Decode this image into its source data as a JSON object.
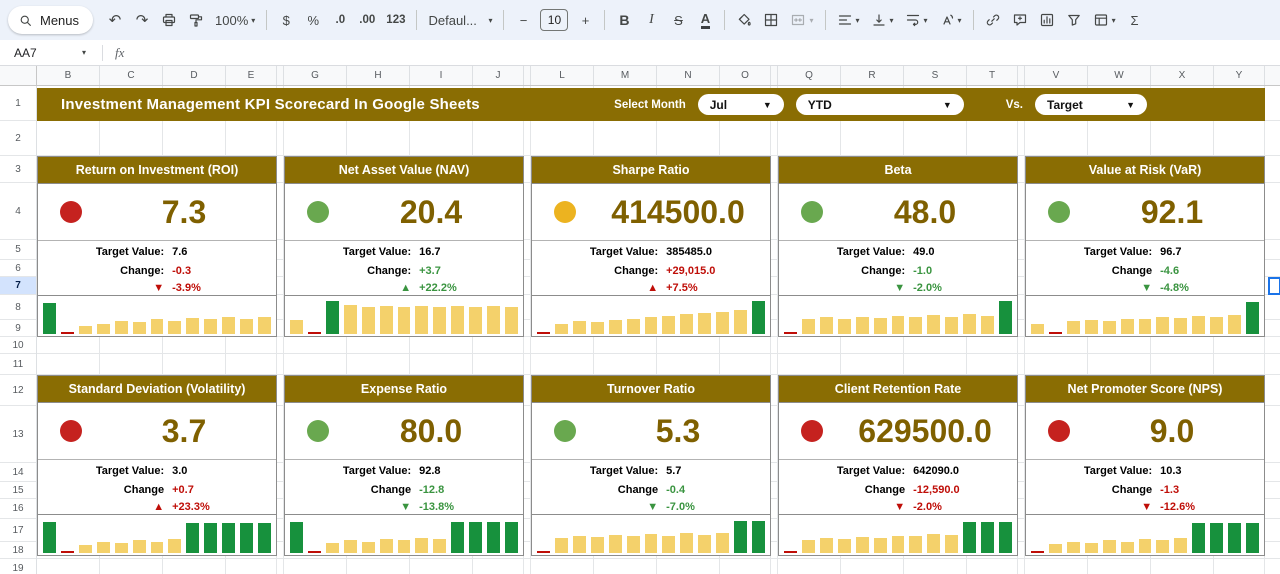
{
  "colors": {
    "gold_bg": "#8a6d03",
    "gold_text": "#7f6000",
    "status_red": "#c5221f",
    "status_green": "#69a84f",
    "status_yellow": "#ecb320",
    "negative_text": "#bf0e08",
    "positive_text": "#3a9440",
    "green_bar": "#17913d",
    "yellow_bar": "#f4d16b",
    "selection": "#1a73e8",
    "active_row_bg": "#d3e3fd"
  },
  "icons": {
    "undo": "↶",
    "redo": "↷",
    "caret": "▾",
    "minus": "−",
    "plus": "+",
    "up": "▲",
    "down": "▼"
  },
  "toolbar": {
    "menus_label": "Menus",
    "zoom_value": "100%",
    "currency_label": "$",
    "percent_label": "%",
    "decrease_decimal_label": ".0",
    "increase_decimal_label": ".00",
    "more_formats_label": "123",
    "font_value": "Defaul...",
    "font_size_value": "10",
    "bold_label": "B",
    "italic_label": "I",
    "strikethrough_label": "S",
    "text_color_label": "A",
    "functions_label": "Σ"
  },
  "formula_bar": {
    "cell_reference": "AA7",
    "fx_label": "fx"
  },
  "grid": {
    "columns": [
      "B",
      "C",
      "D",
      "E",
      "G",
      "H",
      "I",
      "J",
      "L",
      "M",
      "N",
      "O",
      "Q",
      "R",
      "S",
      "T",
      "V",
      "W",
      "X",
      "Y"
    ],
    "rows": [
      "1",
      "2",
      "3",
      "4",
      "5",
      "6",
      "7",
      "8",
      "9",
      "10",
      "11",
      "12",
      "13",
      "14",
      "15",
      "16",
      "17",
      "18",
      "19"
    ],
    "active_row": "7"
  },
  "banner": {
    "title": "Investment Management KPI Scorecard In Google Sheets",
    "select_month_label": "Select Month",
    "month_value": "Jul",
    "period_value": "YTD",
    "vs_label": "Vs.",
    "compare_value": "Target"
  },
  "cards": [
    {
      "title": "Return on Investment (ROI)",
      "status": "red",
      "value": "7.3",
      "target_label": "Target Value:",
      "target": "7.6",
      "change_label": "Change:",
      "change": "-0.3",
      "change_color": "red",
      "trend": "down",
      "trend_color": "red",
      "trend_pct": "-3.9%",
      "bars": [
        {
          "c": "g",
          "h": 90
        },
        {
          "c": "r",
          "h": 6
        },
        {
          "c": "y",
          "h": 22
        },
        {
          "c": "y",
          "h": 30
        },
        {
          "c": "y",
          "h": 38
        },
        {
          "c": "y",
          "h": 34
        },
        {
          "c": "y",
          "h": 42
        },
        {
          "c": "y",
          "h": 38
        },
        {
          "c": "y",
          "h": 46
        },
        {
          "c": "y",
          "h": 42
        },
        {
          "c": "y",
          "h": 48
        },
        {
          "c": "y",
          "h": 44
        },
        {
          "c": "y",
          "h": 50
        }
      ]
    },
    {
      "title": "Net Asset Value (NAV)",
      "status": "green",
      "value": "20.4",
      "target_label": "Target Value:",
      "target": "16.7",
      "change_label": "Change:",
      "change": "+3.7",
      "change_color": "green",
      "trend": "up",
      "trend_color": "green",
      "trend_pct": "+22.2%",
      "bars": [
        {
          "c": "y",
          "h": 40
        },
        {
          "c": "r",
          "h": 6
        },
        {
          "c": "g",
          "h": 95
        },
        {
          "c": "y",
          "h": 82
        },
        {
          "c": "y",
          "h": 78
        },
        {
          "c": "y",
          "h": 80
        },
        {
          "c": "y",
          "h": 76
        },
        {
          "c": "y",
          "h": 80
        },
        {
          "c": "y",
          "h": 76
        },
        {
          "c": "y",
          "h": 80
        },
        {
          "c": "y",
          "h": 78
        },
        {
          "c": "y",
          "h": 80
        },
        {
          "c": "y",
          "h": 78
        }
      ]
    },
    {
      "title": "Sharpe Ratio",
      "status": "yellow",
      "value": "414500.0",
      "target_label": "Target Value:",
      "target": "385485.0",
      "change_label": "Change:",
      "change": "+29,015.0",
      "change_color": "red",
      "trend": "up",
      "trend_color": "red",
      "trend_pct": "+7.5%",
      "bars": [
        {
          "c": "r",
          "h": 6
        },
        {
          "c": "y",
          "h": 30
        },
        {
          "c": "y",
          "h": 36
        },
        {
          "c": "y",
          "h": 34
        },
        {
          "c": "y",
          "h": 40
        },
        {
          "c": "y",
          "h": 44
        },
        {
          "c": "y",
          "h": 48
        },
        {
          "c": "y",
          "h": 52
        },
        {
          "c": "y",
          "h": 56
        },
        {
          "c": "y",
          "h": 60
        },
        {
          "c": "y",
          "h": 64
        },
        {
          "c": "y",
          "h": 68
        },
        {
          "c": "g",
          "h": 95
        }
      ]
    },
    {
      "title": "Beta",
      "status": "green",
      "value": "48.0",
      "target_label": "Target Value:",
      "target": "49.0",
      "change_label": "Change:",
      "change": "-1.0",
      "change_color": "green",
      "trend": "down",
      "trend_color": "green",
      "trend_pct": "-2.0%",
      "bars": [
        {
          "c": "r",
          "h": 6
        },
        {
          "c": "y",
          "h": 42
        },
        {
          "c": "y",
          "h": 48
        },
        {
          "c": "y",
          "h": 44
        },
        {
          "c": "y",
          "h": 50
        },
        {
          "c": "y",
          "h": 46
        },
        {
          "c": "y",
          "h": 52
        },
        {
          "c": "y",
          "h": 48
        },
        {
          "c": "y",
          "h": 54
        },
        {
          "c": "y",
          "h": 50
        },
        {
          "c": "y",
          "h": 56
        },
        {
          "c": "y",
          "h": 52
        },
        {
          "c": "g",
          "h": 95
        }
      ]
    },
    {
      "title": "Value at Risk (VaR)",
      "status": "green",
      "value": "92.1",
      "target_label": "Target Value:",
      "target": "96.7",
      "change_label": "Change",
      "change": "-4.6",
      "change_color": "green",
      "trend": "down",
      "trend_color": "green",
      "trend_pct": "-4.8%",
      "bars": [
        {
          "c": "y",
          "h": 30
        },
        {
          "c": "r",
          "h": 6
        },
        {
          "c": "y",
          "h": 36
        },
        {
          "c": "y",
          "h": 40
        },
        {
          "c": "y",
          "h": 38
        },
        {
          "c": "y",
          "h": 44
        },
        {
          "c": "y",
          "h": 42
        },
        {
          "c": "y",
          "h": 48
        },
        {
          "c": "y",
          "h": 46
        },
        {
          "c": "y",
          "h": 52
        },
        {
          "c": "y",
          "h": 50
        },
        {
          "c": "y",
          "h": 54
        },
        {
          "c": "g",
          "h": 92
        }
      ]
    },
    {
      "title": "Standard Deviation (Volatility)",
      "status": "red",
      "value": "3.7",
      "target_label": "Target Value:",
      "target": "3.0",
      "change_label": "Change",
      "change": "+0.7",
      "change_color": "red",
      "trend": "up",
      "trend_color": "red",
      "trend_pct": "+23.3%",
      "bars": [
        {
          "c": "g",
          "h": 90
        },
        {
          "c": "r",
          "h": 6
        },
        {
          "c": "y",
          "h": 24
        },
        {
          "c": "y",
          "h": 32
        },
        {
          "c": "y",
          "h": 28
        },
        {
          "c": "y",
          "h": 36
        },
        {
          "c": "y",
          "h": 32
        },
        {
          "c": "y",
          "h": 40
        },
        {
          "c": "g",
          "h": 85
        },
        {
          "c": "g",
          "h": 85
        },
        {
          "c": "g",
          "h": 85
        },
        {
          "c": "g",
          "h": 85
        },
        {
          "c": "g",
          "h": 85
        }
      ]
    },
    {
      "title": "Expense Ratio",
      "status": "green",
      "value": "80.0",
      "target_label": "Target Value:",
      "target": "92.8",
      "change_label": "Change",
      "change": "-12.8",
      "change_color": "green",
      "trend": "down",
      "trend_color": "green",
      "trend_pct": "-13.8%",
      "bars": [
        {
          "c": "g",
          "h": 90
        },
        {
          "c": "r",
          "h": 6
        },
        {
          "c": "y",
          "h": 30
        },
        {
          "c": "y",
          "h": 36
        },
        {
          "c": "y",
          "h": 32
        },
        {
          "c": "y",
          "h": 40
        },
        {
          "c": "y",
          "h": 36
        },
        {
          "c": "y",
          "h": 44
        },
        {
          "c": "y",
          "h": 40
        },
        {
          "c": "g",
          "h": 88
        },
        {
          "c": "g",
          "h": 88
        },
        {
          "c": "g",
          "h": 88
        },
        {
          "c": "g",
          "h": 88
        }
      ]
    },
    {
      "title": "Turnover Ratio",
      "status": "green",
      "value": "5.3",
      "target_label": "Target Value:",
      "target": "5.7",
      "change_label": "Change",
      "change": "-0.4",
      "change_color": "green",
      "trend": "down",
      "trend_color": "green",
      "trend_pct": "-7.0%",
      "bars": [
        {
          "c": "r",
          "h": 6
        },
        {
          "c": "y",
          "h": 44
        },
        {
          "c": "y",
          "h": 50
        },
        {
          "c": "y",
          "h": 46
        },
        {
          "c": "y",
          "h": 52
        },
        {
          "c": "y",
          "h": 48
        },
        {
          "c": "y",
          "h": 54
        },
        {
          "c": "y",
          "h": 50
        },
        {
          "c": "y",
          "h": 56
        },
        {
          "c": "y",
          "h": 52
        },
        {
          "c": "y",
          "h": 58
        },
        {
          "c": "g",
          "h": 92
        },
        {
          "c": "g",
          "h": 92
        }
      ]
    },
    {
      "title": "Client Retention Rate",
      "status": "red",
      "value": "629500.0",
      "target_label": "Target Value:",
      "target": "642090.0",
      "change_label": "Change",
      "change": "-12,590.0",
      "change_color": "red",
      "trend": "down",
      "trend_color": "red",
      "trend_pct": "-2.0%",
      "bars": [
        {
          "c": "r",
          "h": 6
        },
        {
          "c": "y",
          "h": 36
        },
        {
          "c": "y",
          "h": 42
        },
        {
          "c": "y",
          "h": 40
        },
        {
          "c": "y",
          "h": 46
        },
        {
          "c": "y",
          "h": 44
        },
        {
          "c": "y",
          "h": 50
        },
        {
          "c": "y",
          "h": 48
        },
        {
          "c": "y",
          "h": 54
        },
        {
          "c": "y",
          "h": 52
        },
        {
          "c": "g",
          "h": 88
        },
        {
          "c": "g",
          "h": 88
        },
        {
          "c": "g",
          "h": 88
        }
      ]
    },
    {
      "title": "Net Promoter Score (NPS)",
      "status": "red",
      "value": "9.0",
      "target_label": "Target Value:",
      "target": "10.3",
      "change_label": "Change",
      "change": "-1.3",
      "change_color": "red",
      "trend": "down",
      "trend_color": "red",
      "trend_pct": "-12.6%",
      "bars": [
        {
          "c": "r",
          "h": 6
        },
        {
          "c": "y",
          "h": 26
        },
        {
          "c": "y",
          "h": 32
        },
        {
          "c": "y",
          "h": 28
        },
        {
          "c": "y",
          "h": 36
        },
        {
          "c": "y",
          "h": 32
        },
        {
          "c": "y",
          "h": 40
        },
        {
          "c": "y",
          "h": 36
        },
        {
          "c": "y",
          "h": 44
        },
        {
          "c": "g",
          "h": 85
        },
        {
          "c": "g",
          "h": 85
        },
        {
          "c": "g",
          "h": 85
        },
        {
          "c": "g",
          "h": 85
        }
      ]
    }
  ]
}
